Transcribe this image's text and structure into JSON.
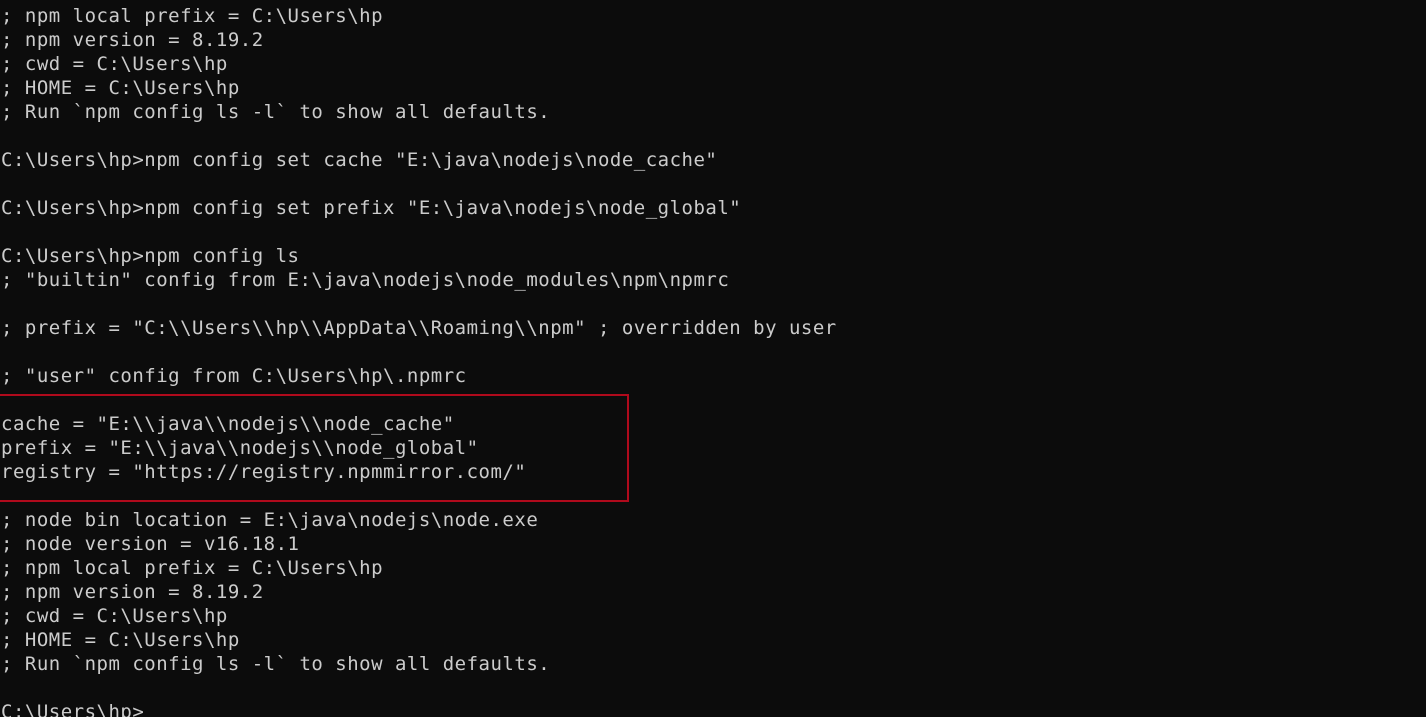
{
  "terminal": {
    "lines": [
      "; npm local prefix = C:\\Users\\hp",
      "; npm version = 8.19.2",
      "; cwd = C:\\Users\\hp",
      "; HOME = C:\\Users\\hp",
      "; Run `npm config ls -l` to show all defaults.",
      "",
      "C:\\Users\\hp>npm config set cache \"E:\\java\\nodejs\\node_cache\"",
      "",
      "C:\\Users\\hp>npm config set prefix \"E:\\java\\nodejs\\node_global\"",
      "",
      "C:\\Users\\hp>npm config ls",
      "; \"builtin\" config from E:\\java\\nodejs\\node_modules\\npm\\npmrc",
      "",
      "; prefix = \"C:\\\\Users\\\\hp\\\\AppData\\\\Roaming\\\\npm\" ; overridden by user",
      "",
      "; \"user\" config from C:\\Users\\hp\\.npmrc",
      "",
      "cache = \"E:\\\\java\\\\nodejs\\\\node_cache\"",
      "prefix = \"E:\\\\java\\\\nodejs\\\\node_global\"",
      "registry = \"https://registry.npmmirror.com/\"",
      "",
      "; node bin location = E:\\java\\nodejs\\node.exe",
      "; node version = v16.18.1",
      "; npm local prefix = C:\\Users\\hp",
      "; npm version = 8.19.2",
      "; cwd = C:\\Users\\hp",
      "; HOME = C:\\Users\\hp",
      "; Run `npm config ls -l` to show all defaults.",
      "",
      "C:\\Users\\hp>"
    ]
  },
  "colors": {
    "background": "#0c0c0c",
    "text": "#cccccc",
    "highlight_border": "#b00a1c"
  }
}
